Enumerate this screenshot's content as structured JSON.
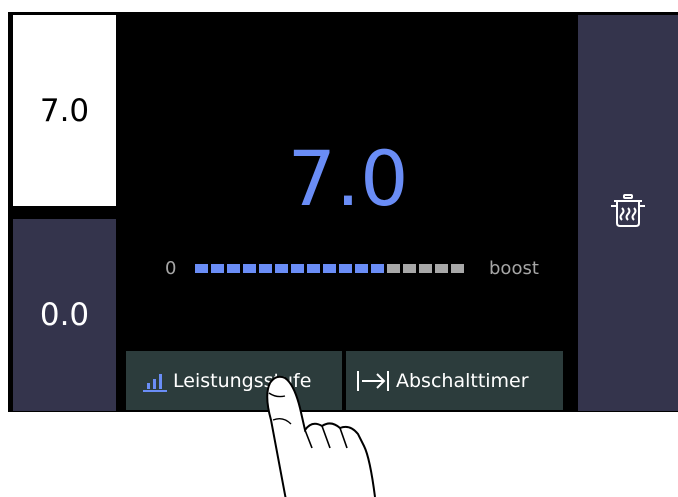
{
  "zones": {
    "front_left_value": "7.0",
    "rear_left_value": "0.0",
    "right_icon": "pot-steam-icon"
  },
  "level": {
    "value": "7.0",
    "scale_min": "0",
    "scale_max": "boost",
    "segments_total": 17,
    "segments_active": 12
  },
  "tabs": {
    "level_label": "Leistungsstufe",
    "level_icon": "power-level-icon",
    "timer_label": "Abschalttimer",
    "timer_icon": "arrow-to-bar-icon"
  },
  "colors": {
    "accent": "#6a8df6",
    "zone_bg": "#34344c",
    "tab_bg": "#2c3c3c",
    "segment_inactive": "#a8a8a8"
  }
}
